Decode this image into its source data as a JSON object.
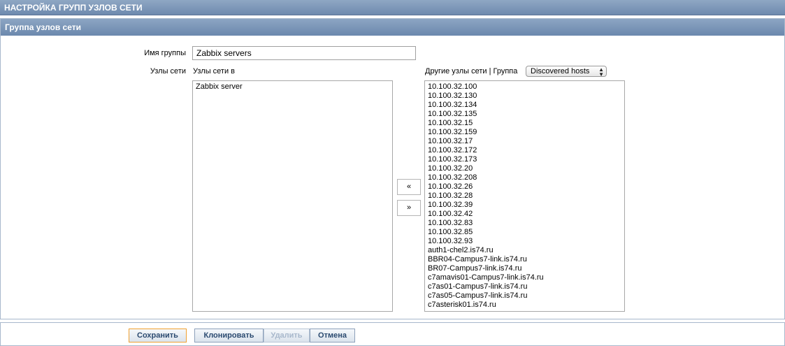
{
  "page": {
    "title": "НАСТРОЙКА ГРУПП УЗЛОВ СЕТИ"
  },
  "form": {
    "header": "Группа узлов сети",
    "group_name_label": "Имя группы",
    "group_name_value": "Zabbix servers",
    "hosts_label": "Узлы сети",
    "hosts_in_label": "Узлы сети в",
    "other_hosts_label": "Другие узлы сети | Группа",
    "group_select_value": "Discovered hosts",
    "hosts_in": [
      "Zabbix server"
    ],
    "other_hosts": [
      "10.100.32.100",
      "10.100.32.130",
      "10.100.32.134",
      "10.100.32.135",
      "10.100.32.15",
      "10.100.32.159",
      "10.100.32.17",
      "10.100.32.172",
      "10.100.32.173",
      "10.100.32.20",
      "10.100.32.208",
      "10.100.32.26",
      "10.100.32.28",
      "10.100.32.39",
      "10.100.32.42",
      "10.100.32.83",
      "10.100.32.85",
      "10.100.32.93",
      "auth1-chel2.is74.ru",
      "BBR04-Campus7-link.is74.ru",
      "BR07-Campus7-link.is74.ru",
      "c7amavis01-Campus7-link.is74.ru",
      "c7as01-Campus7-link.is74.ru",
      "c7as05-Campus7-link.is74.ru",
      "c7asterisk01.is74.ru"
    ],
    "move_left_label": "«",
    "move_right_label": "»"
  },
  "footer": {
    "save_label": "Сохранить",
    "clone_label": "Клонировать",
    "delete_label": "Удалить",
    "cancel_label": "Отмена"
  },
  "colors": {
    "header_bg": "#6e8aae",
    "primary_border": "#f0a030"
  }
}
